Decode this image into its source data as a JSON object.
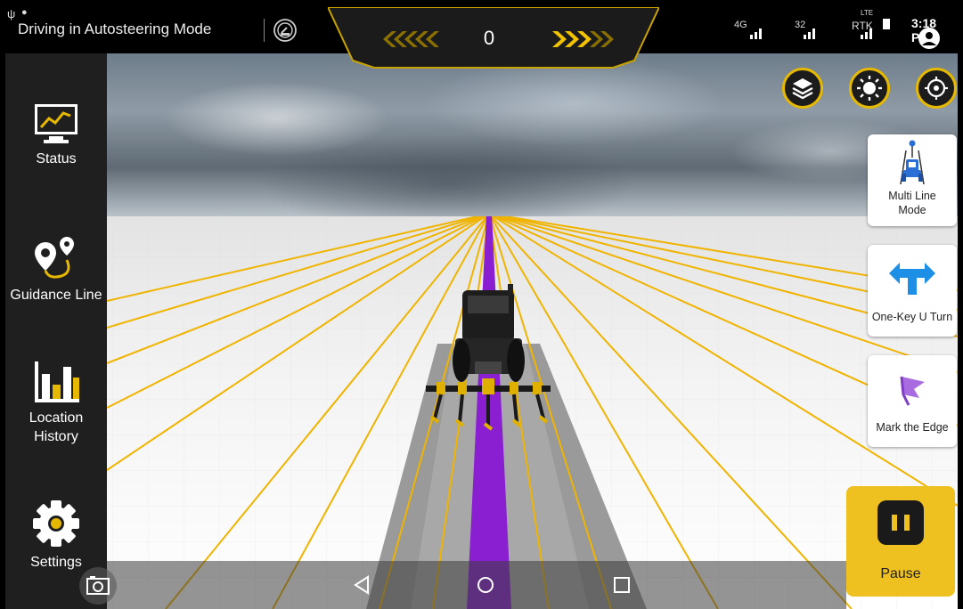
{
  "status_bar": {
    "title": "Driving in Autosteering Mode",
    "speed_value": "0",
    "signal_4g": "4G",
    "satellite_count": "32",
    "rtk_label": "RTK",
    "lte_label": "LTE",
    "clock": "3:18 PM"
  },
  "sidebar": {
    "items": [
      {
        "label": "Status"
      },
      {
        "label": "Guidance Line"
      },
      {
        "label_line1": "Location",
        "label_line2": "History"
      },
      {
        "label": "Settings"
      }
    ]
  },
  "right_panel": {
    "layers_icon": "layers-icon",
    "brightness_icon": "sun-icon",
    "locate_icon": "crosshair-icon",
    "cards": [
      {
        "label_line1": "Multi Line",
        "label_line2": "Mode",
        "icon": "tractor-lines-icon"
      },
      {
        "label": "One-Key U Turn",
        "icon": "u-turn-arrow-icon"
      },
      {
        "label": "Mark the Edge",
        "icon": "flag-icon"
      }
    ],
    "pause_label": "Pause"
  },
  "colors": {
    "accent": "#e6b800",
    "guidance_line": "#8a1fd1",
    "guide_lines": "#f0b400",
    "sidebar_bg": "#1f1f1f",
    "pause_bg": "#eec020"
  }
}
